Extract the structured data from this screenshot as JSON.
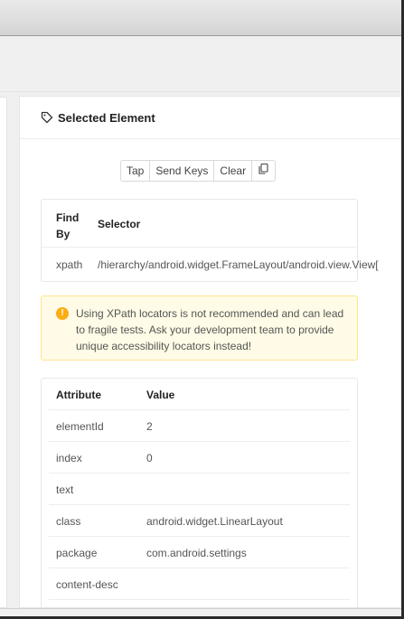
{
  "panel": {
    "title": "Selected Element",
    "icon": "tag-icon"
  },
  "actions": {
    "tap": "Tap",
    "send_keys": "Send Keys",
    "clear": "Clear",
    "copy_icon": "copy-icon"
  },
  "selector_table": {
    "headers": [
      "Find By",
      "Selector"
    ],
    "find_by_line1": "Find",
    "find_by_line2": "By",
    "row": {
      "find_by": "xpath",
      "selector": "/hierarchy/android.widget.FrameLayout/android.view.View["
    }
  },
  "warning": {
    "icon": "warning-icon",
    "text": "Using XPath locators is not recommended and can lead to fragile tests. Ask your development team to provide unique accessibility locators instead!"
  },
  "attributes": {
    "headers": {
      "attribute": "Attribute",
      "value": "Value"
    },
    "rows": [
      {
        "key": "elementId",
        "value": "2"
      },
      {
        "key": "index",
        "value": "0"
      },
      {
        "key": "text",
        "value": ""
      },
      {
        "key": "class",
        "value": "android.widget.LinearLayout"
      },
      {
        "key": "package",
        "value": "com.android.settings"
      },
      {
        "key": "content-desc",
        "value": ""
      }
    ]
  },
  "colors": {
    "warning_bg": "#fffbe6",
    "warning_border": "#ffe58f",
    "warning_icon": "#faad14"
  }
}
